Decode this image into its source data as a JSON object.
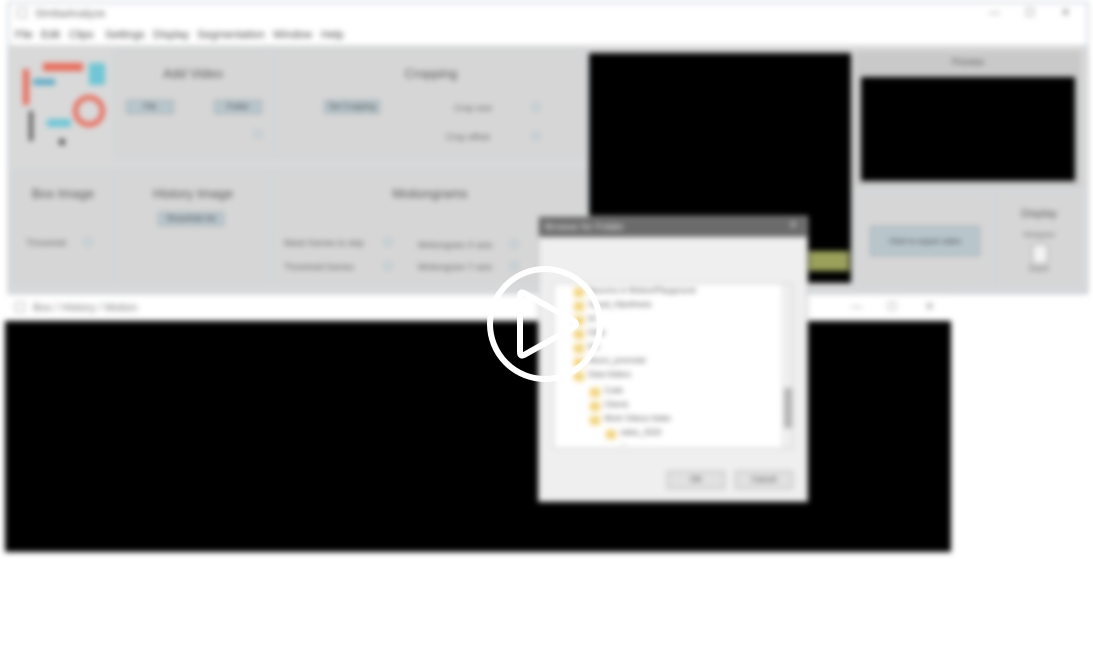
{
  "main_window": {
    "title": "SimbaAnalyze",
    "menu": [
      "File",
      "Edit",
      "Clips",
      "Settings",
      "Display",
      "Segmentation",
      "Window",
      "Help"
    ],
    "add_video": {
      "heading": "Add Video",
      "btn1": "File",
      "btn2": "Folder"
    },
    "cropping": {
      "heading": "Cropping",
      "btn": "Set Cropping",
      "label1": "Crop size",
      "label2": "Crop offset"
    },
    "box_image": {
      "heading": "Box Image",
      "label": "Threshold"
    },
    "history_image": {
      "heading": "History Image",
      "btn": "Show/hide list"
    },
    "motiongrams": {
      "heading": "Motiongrams",
      "label1": "Mask frames to skip",
      "label2": "Threshold frames",
      "label3": "Motiongram X axis",
      "label4": "Motiongram Y axis"
    },
    "preview": {
      "title": "Preview"
    },
    "export_btn": "Click to export video",
    "display": {
      "heading": "Display",
      "sub": "Histogram",
      "icon_label": "Export"
    }
  },
  "second_window": {
    "title": "Box / History / Motion"
  },
  "dialog": {
    "title": "Browse for Folder",
    "tree": [
      "Neurons in Motion/Playground",
      "Visual_Hipothesis",
      "lol",
      "Data",
      "foo",
      "Neuro_promotal",
      "Data folders",
      "Code",
      "Clients",
      "Work Videos folder",
      "video_2020",
      "..."
    ],
    "ok": "OK",
    "cancel": "Cancel"
  },
  "overlay": {
    "icon": "play-icon"
  }
}
